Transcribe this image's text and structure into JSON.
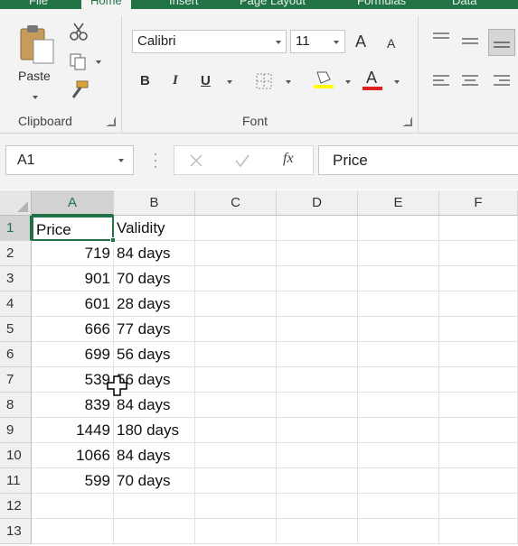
{
  "ribbon": {
    "tabs": [
      "File",
      "Home",
      "Insert",
      "Page Layout",
      "Formulas",
      "Data"
    ],
    "clipboard": {
      "paste_label": "Paste",
      "group_label": "Clipboard"
    },
    "font": {
      "font_name": "Calibri",
      "font_size": "11",
      "bold": "B",
      "italic": "I",
      "underline": "U",
      "group_label": "Font",
      "grow": "A",
      "shrink": "A",
      "color_a": "A"
    }
  },
  "formula_bar": {
    "name_box": "A1",
    "fx": "fx",
    "content": "Price"
  },
  "grid": {
    "columns": [
      "A",
      "B",
      "C",
      "D",
      "E",
      "F"
    ],
    "rows": [
      "1",
      "2",
      "3",
      "4",
      "5",
      "6",
      "7",
      "8",
      "9",
      "10",
      "11",
      "12",
      "13"
    ],
    "col_a": [
      "Price",
      "719",
      "901",
      "601",
      "666",
      "699",
      "539",
      "839",
      "1449",
      "1066",
      "599",
      "",
      ""
    ],
    "col_b": [
      "Validity",
      "84 days",
      "70 days",
      "28 days",
      "77 days",
      "56 days",
      "56 days",
      "84 days",
      "180 days",
      "84 days",
      "70 days",
      "",
      ""
    ]
  },
  "colors": {
    "accent": "#217346",
    "font_color_bar": "#e02020",
    "highlight_bar": "#ffff00"
  }
}
